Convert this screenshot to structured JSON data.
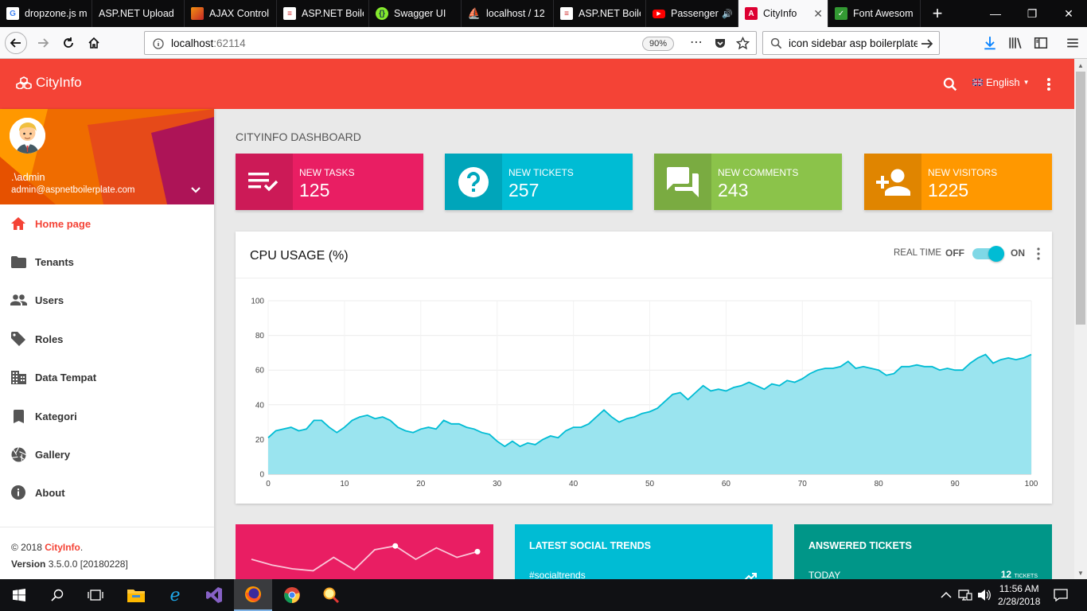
{
  "browser": {
    "tabs": [
      {
        "title": "dropzone.js m",
        "icon": "google-icon",
        "color": "#ffffff"
      },
      {
        "title": "ASP.NET Upload",
        "icon": "aspnet-icon",
        "color": "#5c2d91"
      },
      {
        "title": "AJAX Control",
        "icon": "ajax-icon",
        "color": "#f29111"
      },
      {
        "title": "ASP.NET Boile",
        "icon": "abp-icon",
        "color": "#cf2b2b"
      },
      {
        "title": "Swagger UI",
        "icon": "swagger-icon",
        "color": "#85ea2d"
      },
      {
        "title": "localhost / 12",
        "icon": "phpmyadmin-icon",
        "color": "#f89c0e"
      },
      {
        "title": "ASP.NET Boile",
        "icon": "abp-icon",
        "color": "#cf2b2b"
      },
      {
        "title": "Passenger",
        "icon": "youtube-icon",
        "color": "#ff0000"
      },
      {
        "title": "CityInfo",
        "icon": "angular-icon",
        "color": "#dd0031"
      },
      {
        "title": "Font Awesom",
        "icon": "fontawesome-icon",
        "color": "#339933"
      }
    ],
    "active_tab_title": "CityInfo",
    "url_host": "localhost",
    "url_port": ":62114",
    "zoom": "90%",
    "search_value": "icon sidebar asp boilerplate"
  },
  "app": {
    "brand": "CityInfo",
    "language": "English",
    "colors": {
      "accent": "#f44336",
      "pink": "#e91e63",
      "cyan": "#00bcd4",
      "green": "#8bc34a",
      "orange": "#ff9800",
      "teal": "#009688"
    }
  },
  "sidebar": {
    "user_name": ".\\admin",
    "user_email": "admin@aspnetboilerplate.com",
    "items": [
      {
        "label": "Home page",
        "icon": "home-icon",
        "active": true
      },
      {
        "label": "Tenants",
        "icon": "folder-icon",
        "active": false
      },
      {
        "label": "Users",
        "icon": "people-icon",
        "active": false
      },
      {
        "label": "Roles",
        "icon": "tag-icon",
        "active": false
      },
      {
        "label": "Data Tempat",
        "icon": "building-icon",
        "active": false
      },
      {
        "label": "Kategori",
        "icon": "bookmark-icon",
        "active": false
      },
      {
        "label": "Gallery",
        "icon": "camera-shutter-icon",
        "active": false
      },
      {
        "label": "About",
        "icon": "info-icon",
        "active": false
      }
    ],
    "footer_copyright": "© 2018",
    "footer_brand": "CityInfo",
    "footer_dot": ".",
    "version_label": "Version",
    "version_value": "3.5.0.0 [20180228]"
  },
  "dashboard": {
    "title": "CITYINFO DASHBOARD",
    "info_boxes": [
      {
        "label": "NEW TASKS",
        "value": "125",
        "icon": "playlist-check-icon",
        "color": "#e91e63"
      },
      {
        "label": "NEW TICKETS",
        "value": "257",
        "icon": "help-icon",
        "color": "#00bcd4"
      },
      {
        "label": "NEW COMMENTS",
        "value": "243",
        "icon": "forum-icon",
        "color": "#8bc34a"
      },
      {
        "label": "NEW VISITORS",
        "value": "1225",
        "icon": "person-add-icon",
        "color": "#ff9800"
      }
    ],
    "cpu_card": {
      "title": "CPU USAGE (%)",
      "realtime_label": "REAL TIME",
      "off_label": "OFF",
      "on_label": "ON",
      "realtime_on": true
    },
    "widgets": [
      {
        "title": "",
        "sub": "",
        "right": "",
        "right_small": "",
        "color": "#e91e63"
      },
      {
        "title": "LATEST SOCIAL TRENDS",
        "sub": "#socialtrends",
        "right": "",
        "right_small": "",
        "color": "#00bcd4"
      },
      {
        "title": "ANSWERED TICKETS",
        "sub": "TODAY",
        "right": "12",
        "right_small": "TICKETS",
        "color": "#009688"
      }
    ],
    "sparkline": [
      30,
      24,
      20,
      18,
      32,
      19,
      40,
      44,
      30,
      42,
      32,
      38
    ]
  },
  "chart_data": {
    "type": "area",
    "title": "CPU USAGE (%)",
    "xlabel": "",
    "ylabel": "",
    "xlim": [
      0,
      100
    ],
    "ylim": [
      0,
      100
    ],
    "xticks": [
      0,
      10,
      20,
      30,
      40,
      50,
      60,
      70,
      80,
      90,
      100
    ],
    "yticks": [
      0,
      20,
      40,
      60,
      80,
      100
    ],
    "grid": true,
    "color": "#00bcd4",
    "fill_color": "#9ae4ef",
    "x": [
      0,
      1,
      2,
      3,
      4,
      5,
      6,
      7,
      8,
      9,
      10,
      11,
      12,
      13,
      14,
      15,
      16,
      17,
      18,
      19,
      20,
      21,
      22,
      23,
      24,
      25,
      26,
      27,
      28,
      29,
      30,
      31,
      32,
      33,
      34,
      35,
      36,
      37,
      38,
      39,
      40,
      41,
      42,
      43,
      44,
      45,
      46,
      47,
      48,
      49,
      50,
      51,
      52,
      53,
      54,
      55,
      56,
      57,
      58,
      59,
      60,
      61,
      62,
      63,
      64,
      65,
      66,
      67,
      68,
      69,
      70,
      71,
      72,
      73,
      74,
      75,
      76,
      77,
      78,
      79,
      80,
      81,
      82,
      83,
      84,
      85,
      86,
      87,
      88,
      89,
      90,
      91,
      92,
      93,
      94,
      95,
      96,
      97,
      98,
      99,
      100
    ],
    "values": [
      21,
      25,
      26,
      27,
      25,
      26,
      31,
      31,
      27,
      24,
      27,
      31,
      33,
      34,
      32,
      33,
      31,
      27,
      25,
      24,
      26,
      27,
      26,
      31,
      29,
      29,
      27,
      26,
      24,
      23,
      19,
      16,
      19,
      16,
      18,
      17,
      20,
      22,
      21,
      25,
      27,
      27,
      29,
      33,
      37,
      33,
      30,
      32,
      33,
      35,
      36,
      38,
      42,
      46,
      47,
      43,
      47,
      51,
      48,
      49,
      48,
      50,
      51,
      53,
      51,
      49,
      52,
      51,
      54,
      53,
      55,
      58,
      60,
      61,
      61,
      62,
      65,
      61,
      62,
      61,
      60,
      57,
      58,
      62,
      62,
      63,
      62,
      62,
      60,
      61,
      60,
      60,
      64,
      67,
      69,
      64,
      66,
      67,
      66,
      67,
      69
    ]
  },
  "taskbar": {
    "time": "11:56 AM",
    "date": "2/28/2018"
  }
}
